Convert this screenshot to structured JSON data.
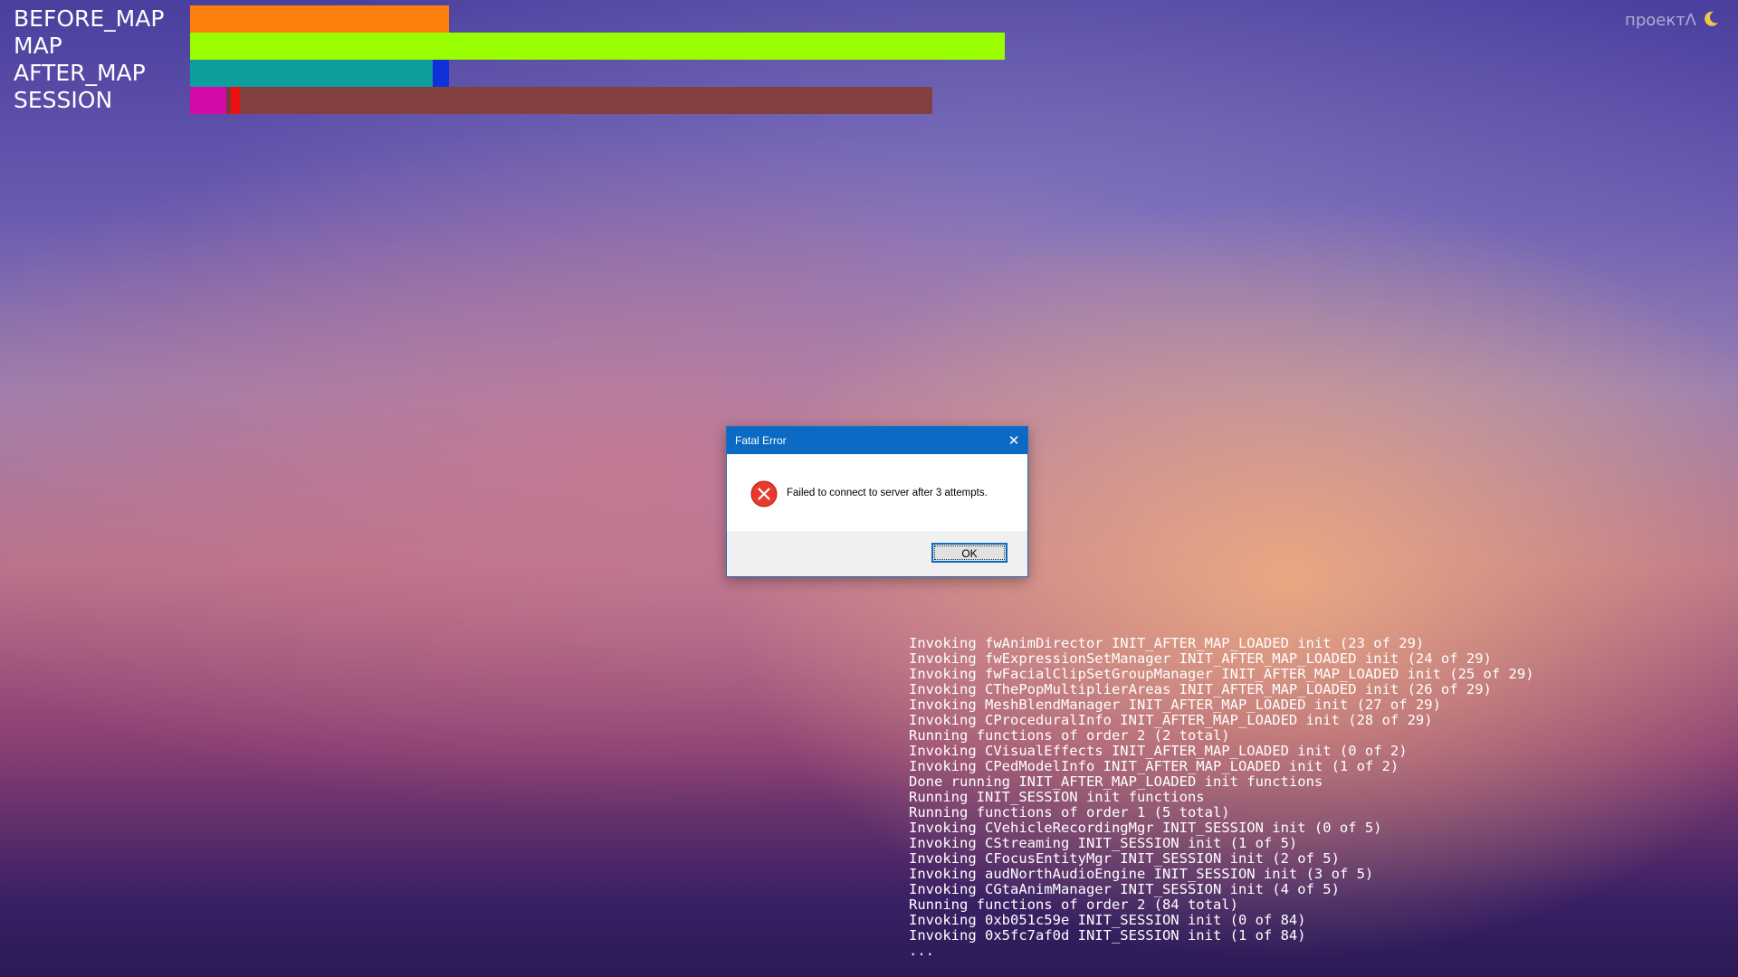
{
  "loading_bars": [
    {
      "label": "BEFORE_MAP",
      "segments": [
        {
          "fraction": 0.2855,
          "color": "#ff7f0e"
        }
      ]
    },
    {
      "label": "MAP",
      "segments": [
        {
          "fraction": 0.9,
          "color": "#99ff00"
        }
      ]
    },
    {
      "label": "AFTER_MAP",
      "segments": [
        {
          "fraction": 0.2675,
          "color": "#0f9e9e"
        },
        {
          "fraction": 0.018,
          "color": "#1030d8"
        }
      ]
    },
    {
      "label": "SESSION",
      "segments": [
        {
          "fraction": 0.04,
          "color": "#d10aa8"
        },
        {
          "fraction": 0.005,
          "color": "#7a3a3a"
        },
        {
          "fraction": 0.01,
          "color": "#ee1111"
        },
        {
          "fraction": 0.765,
          "color": "#824040"
        }
      ]
    }
  ],
  "brand": {
    "text": "проектΛ",
    "icon": "moon-icon"
  },
  "dialog": {
    "title": "Fatal Error",
    "close_icon": "close-icon",
    "error_icon": "error-icon",
    "message": "Failed to connect to server after 3 attempts.",
    "ok_label": "OK",
    "colors": {
      "titlebar": "#0b6ac4",
      "error_red": "#e8392c"
    }
  },
  "console": {
    "lines": [
      "Invoking fwAnimDirector INIT_AFTER_MAP_LOADED init (23 of 29)",
      "Invoking fwExpressionSetManager INIT_AFTER_MAP_LOADED init (24 of 29)",
      "Invoking fwFacialClipSetGroupManager INIT_AFTER_MAP_LOADED init (25 of 29)",
      "Invoking CThePopMultiplierAreas INIT_AFTER_MAP_LOADED init (26 of 29)",
      "Invoking MeshBlendManager INIT_AFTER_MAP_LOADED init (27 of 29)",
      "Invoking CProceduralInfo INIT_AFTER_MAP_LOADED init (28 of 29)",
      "Running functions of order 2 (2 total)",
      "Invoking CVisualEffects INIT_AFTER_MAP_LOADED init (0 of 2)",
      "Invoking CPedModelInfo INIT_AFTER_MAP_LOADED init (1 of 2)",
      "Done running INIT_AFTER_MAP_LOADED init functions",
      "Running INIT_SESSION init functions",
      "Running functions of order 1 (5 total)",
      "Invoking CVehicleRecordingMgr INIT_SESSION init (0 of 5)",
      "Invoking CStreaming INIT_SESSION init (1 of 5)",
      "Invoking CFocusEntityMgr INIT_SESSION init (2 of 5)",
      "Invoking audNorthAudioEngine INIT_SESSION init (3 of 5)",
      "Invoking CGtaAnimManager INIT_SESSION init (4 of 5)",
      "Running functions of order 2 (84 total)",
      "Invoking 0xb051c59e INIT_SESSION init (0 of 84)",
      "Invoking 0x5fc7af0d INIT_SESSION init (1 of 84)",
      "..."
    ]
  }
}
